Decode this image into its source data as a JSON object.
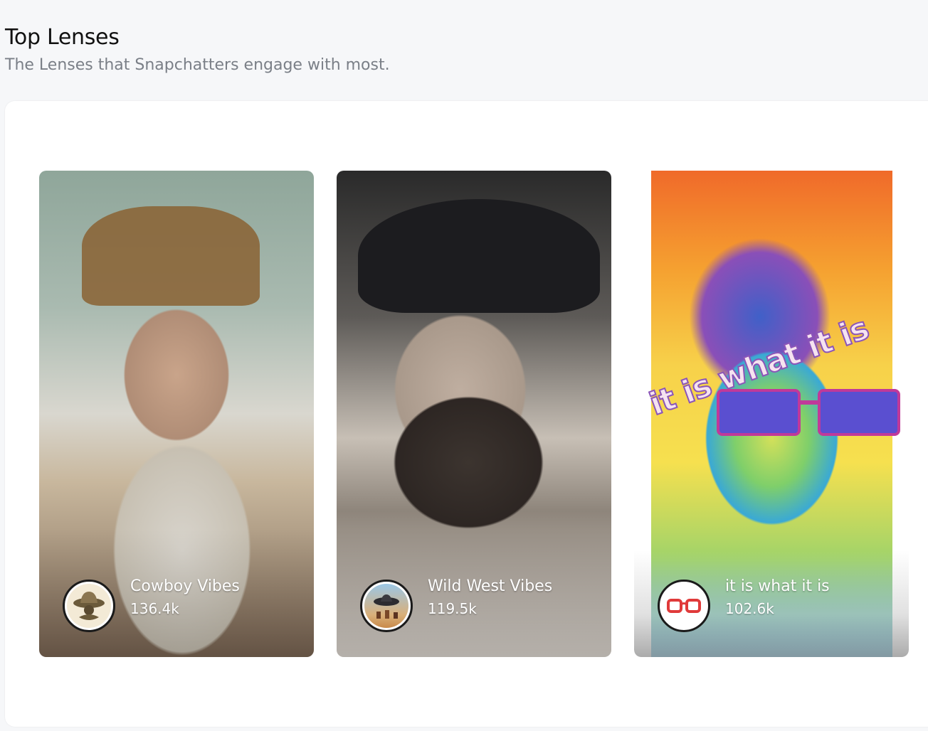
{
  "header": {
    "title": "Top Lenses",
    "subtitle": "The Lenses that Snapchatters engage with most."
  },
  "lenses": [
    {
      "name": "Cowboy Vibes",
      "count": "136.4k",
      "icon": "cowboy-hat-icon"
    },
    {
      "name": "Wild West Vibes",
      "count": "119.5k",
      "icon": "wild-west-scene-icon"
    },
    {
      "name": "it is what it is",
      "count": "102.6k",
      "icon": "glasses-icon",
      "overlay_text": "it is what it is"
    }
  ]
}
